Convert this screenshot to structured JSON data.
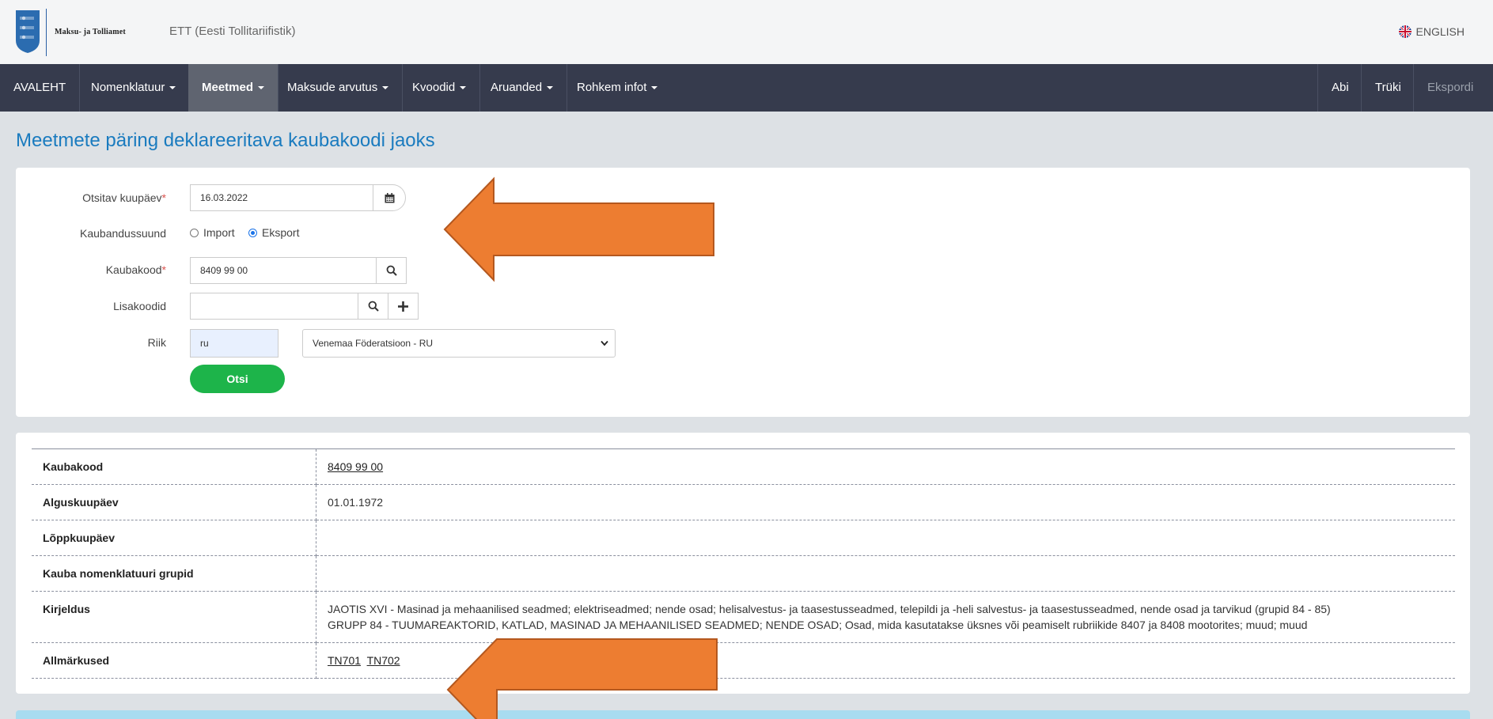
{
  "header": {
    "logo_text": "Maksu- ja Tolliamet",
    "app_title": "ETT (Eesti Tollitariifistik)",
    "language": "ENGLISH"
  },
  "nav": {
    "items": [
      {
        "label": "AVALEHT"
      },
      {
        "label": "Nomenklatuur"
      },
      {
        "label": "Meetmed"
      },
      {
        "label": "Maksude arvutus"
      },
      {
        "label": "Kvoodid"
      },
      {
        "label": "Aruanded"
      },
      {
        "label": "Rohkem infot"
      }
    ],
    "right": {
      "help": "Abi",
      "print": "Trüki",
      "export": "Ekspordi"
    }
  },
  "page": {
    "title": "Meetmete päring deklareeritava kaubakoodi jaoks"
  },
  "form": {
    "date_label": "Otsitav kuupäev",
    "date_value": "16.03.2022",
    "direction_label": "Kaubandussuund",
    "direction_options": [
      "Import",
      "Eksport"
    ],
    "direction_selected": "Eksport",
    "code_label": "Kaubakood",
    "code_value": "8409 99 00",
    "extra_label": "Lisakoodid",
    "extra_value": "",
    "country_label": "Riik",
    "country_code": "ru",
    "country_selected": "Venemaa Föderatsioon - RU",
    "search_button": "Otsi",
    "required_mark": "*"
  },
  "results": {
    "rows": [
      {
        "key": "Kaubakood",
        "value": "8409 99 00"
      },
      {
        "key": "Alguskuupäev",
        "value": "01.01.1972"
      },
      {
        "key": "Lõppkuupäev",
        "value": ""
      },
      {
        "key": "Kauba nomenklatuuri grupid",
        "value": ""
      },
      {
        "key": "Kirjeldus",
        "value": "JAOTIS XVI - Masinad ja mehaanilised seadmed; elektriseadmed; nende osad; helisalvestus- ja taasestusseadmed, telepildi ja -heli salvestus- ja taasestusseadmed, nende osad ja tarvikud (grupid 84 - 85)",
        "value2": "GRUPP 84 - TUUMAREAKTORID, KATLAD, MASINAD JA MEHAANILISED SEADMED; NENDE OSAD; Osad, mida kasutatakse üksnes või peamiselt rubriikide 8407 ja 8408 mootorites; muud; muud"
      },
      {
        "key": "Allmärkused",
        "links": [
          "TN701",
          "TN702"
        ]
      }
    ]
  },
  "colors": {
    "nav_bg": "#363b4d",
    "accent": "#1a7bbf",
    "search_button": "#1db44a",
    "annotation_arrow": "#ed7d31"
  }
}
